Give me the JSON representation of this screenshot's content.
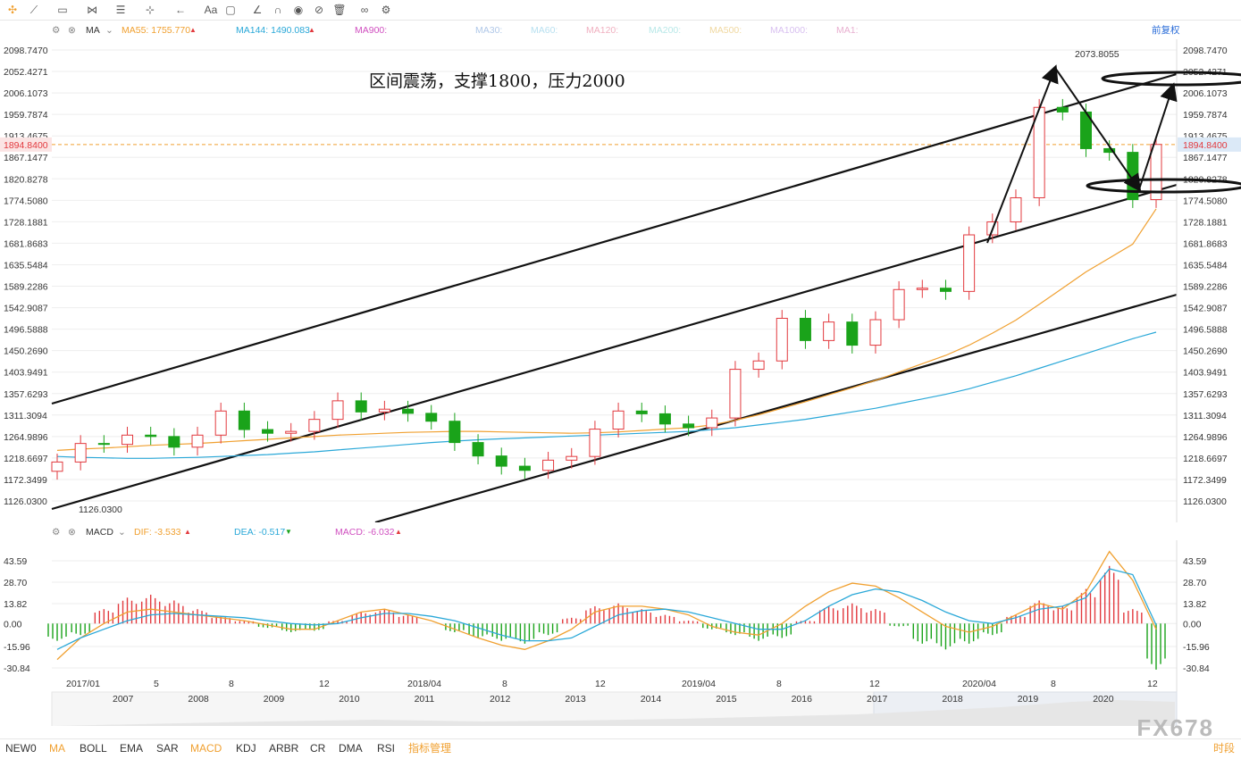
{
  "toolbar": {
    "icons": [
      "crosshair-icon",
      "trend-tool-icon",
      "rect-tool-icon",
      "pattern-icon",
      "fib-icon",
      "gann-icon",
      "arrow-icon",
      "text-icon",
      "note-icon",
      "ruler-icon",
      "magnet-icon",
      "eye-icon",
      "lock-icon",
      "trash-icon",
      "link-icon",
      "settings-icon"
    ],
    "text_tool_label": "Aa"
  },
  "main_legend": {
    "indicator": "MA",
    "ma55": "MA55: 1755.770",
    "ma144": "MA144: 1490.083",
    "ma900": "MA900:",
    "ma30": "MA30:",
    "ma60": "MA60:",
    "ma120": "MA120:",
    "ma200": "MA200:",
    "ma500": "MA500:",
    "ma1000": "MA1000:",
    "ma1": "MA1:",
    "adjust": "前复权"
  },
  "colors": {
    "up": "#e2393e",
    "down": "#1aa31a",
    "ma55": "#f0a030",
    "ma144": "#2aa8d8",
    "dif": "#f0a030",
    "dea": "#2aa8d8",
    "macd_label": "#d050c0",
    "grid": "#eeeeee",
    "trend": "#111111"
  },
  "annotation": {
    "text": "区间震荡，支撑1800，压力2000",
    "high_label": "2073.8055",
    "low_label": "1126.0300",
    "current_price": "1894.8400"
  },
  "macd_legend": {
    "indicator": "MACD",
    "dif": "DIF: -3.533",
    "dea": "DEA: -0.517",
    "macd": "MACD: -6.032"
  },
  "time_axis": [
    "2017/01",
    "5",
    "8",
    "12",
    "2018/04",
    "8",
    "12",
    "2019/04",
    "8",
    "12",
    "2020/04",
    "8",
    "12"
  ],
  "overview_years": [
    "2007",
    "2008",
    "2009",
    "2010",
    "2011",
    "2012",
    "2013",
    "2014",
    "2015",
    "2016",
    "2017",
    "2018",
    "2019",
    "2020"
  ],
  "bottom_bar": {
    "items": [
      "NEW0",
      "MA",
      "BOLL",
      "EMA",
      "SAR",
      "MACD",
      "KDJ",
      "ARBR",
      "CR",
      "DMA",
      "RSI",
      "指标管理"
    ],
    "right": "时段"
  },
  "watermark": "FX678",
  "chart_data": [
    {
      "type": "candlestick",
      "title": "",
      "y_ticks": [
        "2098.7470",
        "2052.4271",
        "2006.1073",
        "1959.7874",
        "1913.4675",
        "1867.1477",
        "1820.8278",
        "1774.5080",
        "1728.1881",
        "1681.8683",
        "1635.5484",
        "1589.2286",
        "1542.9087",
        "1496.5888",
        "1450.2690",
        "1403.9491",
        "1357.6293",
        "1311.3094",
        "1264.9896",
        "1218.6697",
        "1172.3499",
        "1126.0300"
      ],
      "ylim": [
        1100,
        2110
      ],
      "x": [
        "2017-01",
        "2017-02",
        "2017-03",
        "2017-04",
        "2017-05",
        "2017-06",
        "2017-07",
        "2017-08",
        "2017-09",
        "2017-10",
        "2017-11",
        "2017-12",
        "2018-01",
        "2018-02",
        "2018-03",
        "2018-04",
        "2018-05",
        "2018-06",
        "2018-07",
        "2018-08",
        "2018-09",
        "2018-10",
        "2018-11",
        "2018-12",
        "2019-01",
        "2019-02",
        "2019-03",
        "2019-04",
        "2019-05",
        "2019-06",
        "2019-07",
        "2019-08",
        "2019-09",
        "2019-10",
        "2019-11",
        "2019-12",
        "2020-01",
        "2020-02",
        "2020-03",
        "2020-04",
        "2020-05",
        "2020-06",
        "2020-07",
        "2020-08",
        "2020-09",
        "2020-10",
        "2020-11",
        "2020-12"
      ],
      "close": [
        1210,
        1250,
        1248,
        1268,
        1265,
        1242,
        1268,
        1320,
        1280,
        1272,
        1276,
        1302,
        1342,
        1318,
        1324,
        1315,
        1298,
        1252,
        1223,
        1201,
        1192,
        1214,
        1222,
        1281,
        1320,
        1314,
        1292,
        1284,
        1305,
        1410,
        1428,
        1520,
        1472,
        1512,
        1462,
        1517,
        1582,
        1585,
        1578,
        1700,
        1728,
        1780,
        1975,
        1965,
        1886,
        1878,
        1776,
        1895
      ],
      "series": [
        {
          "name": "MA55",
          "values": [
            1235,
            1238,
            1240,
            1243,
            1246,
            1248,
            1250,
            1253,
            1256,
            1259,
            1262,
            1265,
            1268,
            1270,
            1272,
            1274,
            1275,
            1276,
            1276,
            1275,
            1274,
            1273,
            1272,
            1273,
            1275,
            1278,
            1281,
            1284,
            1290,
            1300,
            1312,
            1326,
            1340,
            1355,
            1370,
            1386,
            1404,
            1422,
            1440,
            1462,
            1488,
            1516,
            1550,
            1585,
            1620,
            1650,
            1680,
            1756
          ]
        },
        {
          "name": "MA144",
          "values": [
            1222,
            1220,
            1219,
            1218,
            1218,
            1219,
            1220,
            1222,
            1224,
            1226,
            1229,
            1232,
            1236,
            1240,
            1244,
            1248,
            1252,
            1255,
            1258,
            1260,
            1262,
            1264,
            1266,
            1268,
            1270,
            1272,
            1274,
            1276,
            1280,
            1284,
            1290,
            1296,
            1302,
            1310,
            1318,
            1326,
            1336,
            1346,
            1356,
            1368,
            1382,
            1396,
            1412,
            1428,
            1444,
            1460,
            1476,
            1490
          ]
        }
      ],
      "annotations": [
        "区间震荡，支撑1800，压力2000",
        "2073.8055",
        "1126.0300"
      ]
    },
    {
      "type": "bar",
      "title": "",
      "y_ticks": [
        "43.59",
        "28.70",
        "13.82",
        "0.00",
        "-15.96",
        "-30.84"
      ],
      "ylim": [
        -38,
        55
      ],
      "macd": [
        -12,
        -8,
        10,
        18,
        20,
        16,
        10,
        5,
        2,
        -3,
        -6,
        -5,
        2,
        8,
        10,
        6,
        0,
        -6,
        -10,
        -12,
        -14,
        -8,
        4,
        12,
        14,
        10,
        6,
        2,
        -4,
        -8,
        -12,
        -10,
        2,
        12,
        14,
        10,
        -2,
        -14,
        -18,
        -14,
        -8,
        6,
        16,
        12,
        24,
        40,
        10,
        -32
      ],
      "series": [
        {
          "name": "DIF",
          "values": [
            -25,
            -10,
            0,
            8,
            10,
            8,
            6,
            4,
            2,
            -1,
            -4,
            -4,
            2,
            8,
            10,
            6,
            2,
            -4,
            -10,
            -15,
            -18,
            -12,
            -4,
            8,
            12,
            12,
            10,
            6,
            -2,
            -6,
            -8,
            0,
            12,
            22,
            28,
            26,
            18,
            8,
            -2,
            -6,
            -2,
            6,
            14,
            10,
            22,
            50,
            30,
            -4
          ]
        },
        {
          "name": "DEA",
          "values": [
            -18,
            -10,
            -4,
            2,
            6,
            7,
            6,
            5,
            4,
            2,
            0,
            -1,
            0,
            4,
            7,
            7,
            5,
            2,
            -3,
            -8,
            -12,
            -12,
            -10,
            -2,
            6,
            9,
            10,
            8,
            4,
            0,
            -4,
            -4,
            2,
            12,
            20,
            24,
            22,
            16,
            8,
            2,
            0,
            4,
            10,
            12,
            18,
            38,
            34,
            -1
          ]
        }
      ]
    }
  ]
}
